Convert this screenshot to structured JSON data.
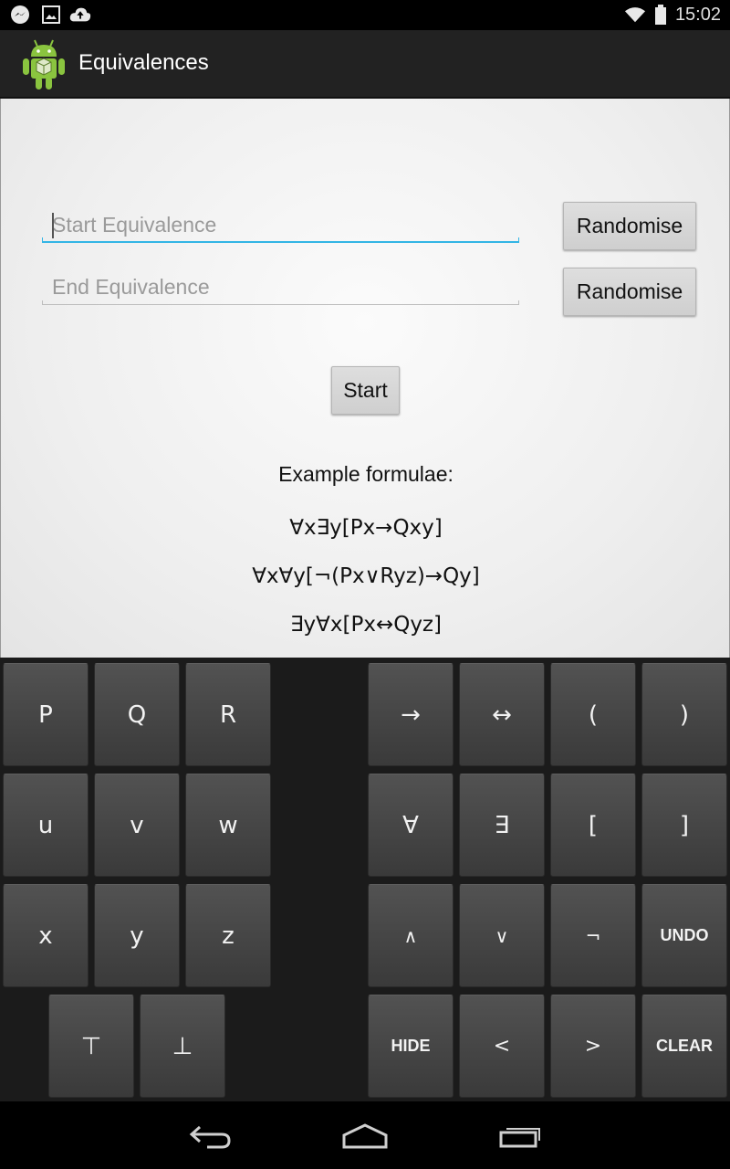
{
  "status_bar": {
    "time": "15:02",
    "left_icons": [
      "messenger-icon",
      "image-icon",
      "cloud-upload-icon"
    ],
    "right_icons": [
      "wifi-icon",
      "battery-icon"
    ]
  },
  "action_bar": {
    "title": "Equivalences",
    "icon": "android-app-icon"
  },
  "form": {
    "start_field": {
      "placeholder": "Start Equivalence",
      "value": ""
    },
    "end_field": {
      "placeholder": "End Equivalence",
      "value": ""
    },
    "randomise_label_1": "Randomise",
    "randomise_label_2": "Randomise",
    "start_label": "Start"
  },
  "examples": {
    "title": "Example formulae:",
    "formulae": [
      "∀x∃y[Px→Qxy]",
      "∀x∀y[¬(Px∨Ryz)→Qy]",
      "∃y∀x[Px↔Qyz]"
    ]
  },
  "keyboard": {
    "keys": {
      "P": "P",
      "Q": "Q",
      "R": "R",
      "u": "u",
      "v": "v",
      "w": "w",
      "x": "x",
      "y": "y",
      "z": "z",
      "top": "⊤",
      "bottom": "⊥",
      "implies": "→",
      "iff": "↔",
      "lparen": "(",
      "rparen": ")",
      "forall": "∀",
      "exists": "∃",
      "lbracket": "[",
      "rbracket": "]",
      "and": "∧",
      "or": "∨",
      "not": "¬",
      "undo": "UNDO",
      "hide": "HIDE",
      "left": "<",
      "right": ">",
      "clear": "CLEAR"
    }
  },
  "nav_bar": {
    "icons": [
      "back-icon",
      "home-icon",
      "recent-apps-icon"
    ]
  },
  "colors": {
    "accent": "#33b5e5",
    "action_bar": "#222222",
    "key_bg": "#474747"
  }
}
